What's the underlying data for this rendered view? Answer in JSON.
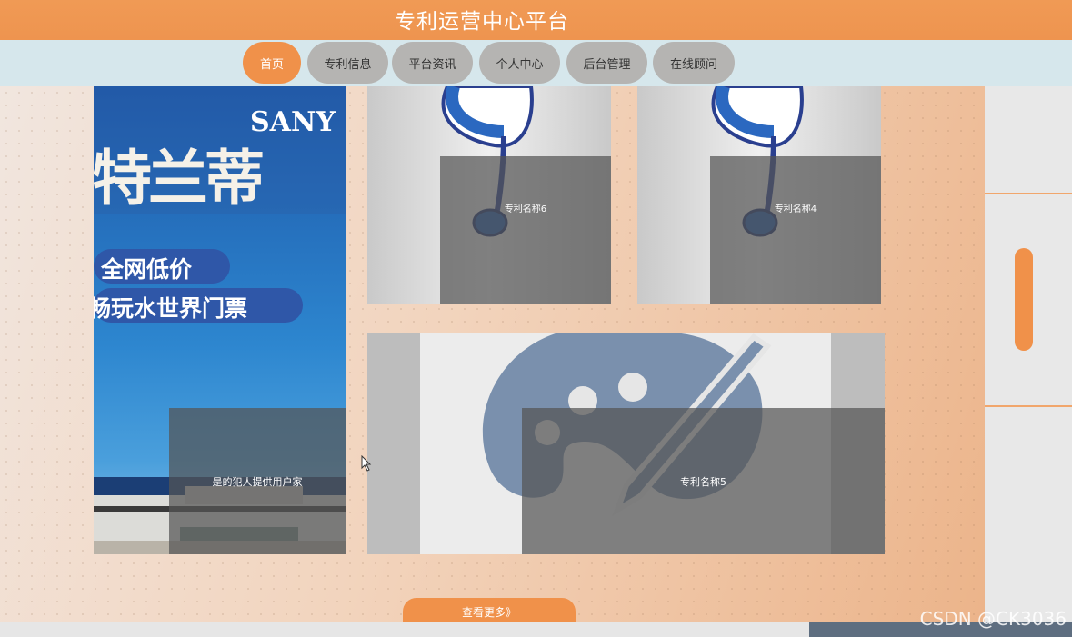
{
  "header": {
    "title": "专利运营中心平台"
  },
  "nav": {
    "items": [
      {
        "label": "首页",
        "active": true
      },
      {
        "label": "专利信息"
      },
      {
        "label": "平台资讯"
      },
      {
        "label": "个人中心"
      },
      {
        "label": "后台管理"
      },
      {
        "label": "在线顾问"
      }
    ]
  },
  "cards": [
    {
      "caption": "是的犯人提供用户家",
      "image_text": {
        "brand": "SANY",
        "headline": "特兰蒂",
        "line1": "全网低价",
        "line2": "畅玩水世界门票"
      }
    },
    {
      "caption": "专利名称6"
    },
    {
      "caption": "专利名称4"
    },
    {
      "caption": "专利名称5"
    }
  ],
  "more_button": {
    "label": "查看更多》"
  },
  "watermark": "CSDN @CK3036",
  "colors": {
    "accent": "#f0914a",
    "nav_bg": "#d6e7ec",
    "nav_button": "#b5b4b2"
  }
}
